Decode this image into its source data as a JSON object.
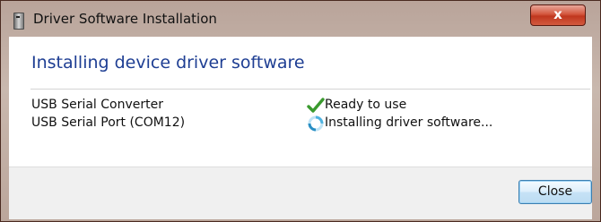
{
  "window": {
    "title": "Driver Software Installation",
    "close_glyph": "x"
  },
  "main": {
    "heading": "Installing device driver software",
    "devices": [
      {
        "name": "USB Serial Converter",
        "status": "Ready to use",
        "status_icon": "check-icon"
      },
      {
        "name": "USB Serial Port (COM12)",
        "status": "Installing driver software...",
        "status_icon": "spinner-icon"
      }
    ]
  },
  "footer": {
    "close_label": "Close"
  },
  "colors": {
    "heading": "#1e3e93",
    "check": "#3a9a2e",
    "spinner": "#4fb3e0"
  }
}
